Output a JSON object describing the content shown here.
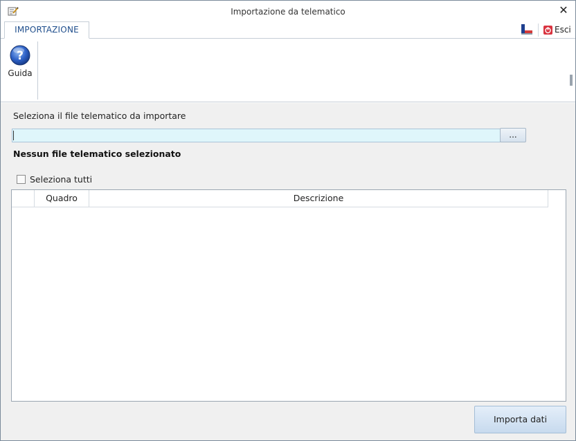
{
  "window": {
    "title": "Importazione da telematico",
    "close_label": "✕"
  },
  "ribbon": {
    "tabs": [
      {
        "label": "IMPORTAZIONE",
        "active": true
      }
    ],
    "right": {
      "flag_icon": "flag-icon",
      "exit_icon": "power-icon",
      "exit_label": "Esci"
    },
    "buttons": [
      {
        "label": "Guida",
        "icon": "help-icon"
      }
    ]
  },
  "form": {
    "file_label": "Seleziona il file telematico da importare",
    "file_value": "",
    "browse_label": "...",
    "status_text": "Nessun file telematico selezionato",
    "select_all_label": "Seleziona tutti",
    "select_all_checked": false
  },
  "grid": {
    "columns": [
      "",
      "Quadro",
      "Descrizione"
    ],
    "rows": []
  },
  "footer": {
    "import_label": "Importa dati"
  },
  "colors": {
    "accent": "#1f4e8c",
    "input_bg": "#dff6fb",
    "content_bg": "#f0f0f0",
    "exit_icon": "#d9333f"
  }
}
